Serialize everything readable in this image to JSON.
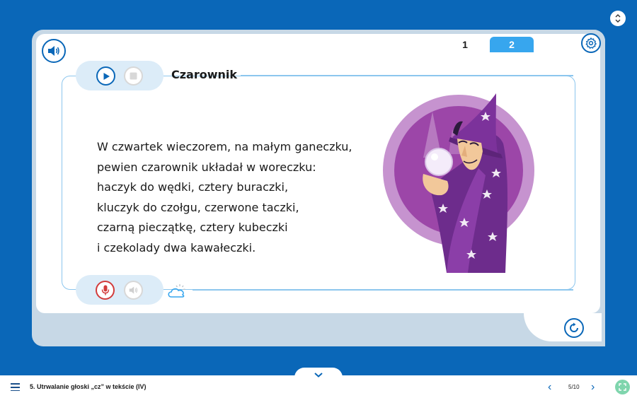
{
  "tabs": [
    {
      "label": "1",
      "active": true
    },
    {
      "label": "2",
      "active": false
    }
  ],
  "exercise": {
    "title": "Czarownik",
    "poem": [
      "W czwartek wieczorem, na małym ganeczku,",
      "pewien czarownik układał w woreczku:",
      "haczyk do wędki, cztery buraczki,",
      "kluczyk do czołgu, czerwone taczki,",
      "czarną pieczątkę, cztery kubeczki",
      "i czekolady dwa kawałeczki."
    ]
  },
  "icons": {
    "speaker": "speaker-icon",
    "settings": "gear-icon",
    "play": "play-icon",
    "stop": "stop-icon",
    "microphone": "microphone-icon",
    "playback": "speaker-icon",
    "weather": "cloud-sun-icon",
    "refresh": "refresh-icon",
    "scroll": "up-down-chevron-icon",
    "menu": "hamburger-menu-icon",
    "fullscreen": "fullscreen-icon"
  },
  "footer": {
    "lesson_title": "5. Utrwalanie głoski „cz” w tekście (IV)",
    "page_indicator": "5/10",
    "prev_label": "‹",
    "next_label": "›"
  },
  "colors": {
    "background": "#0a67b8",
    "frame": "#c7d8e6",
    "accent": "#37a6ee",
    "record": "#d23b3b",
    "fullscreen": "#7fd5ad"
  }
}
